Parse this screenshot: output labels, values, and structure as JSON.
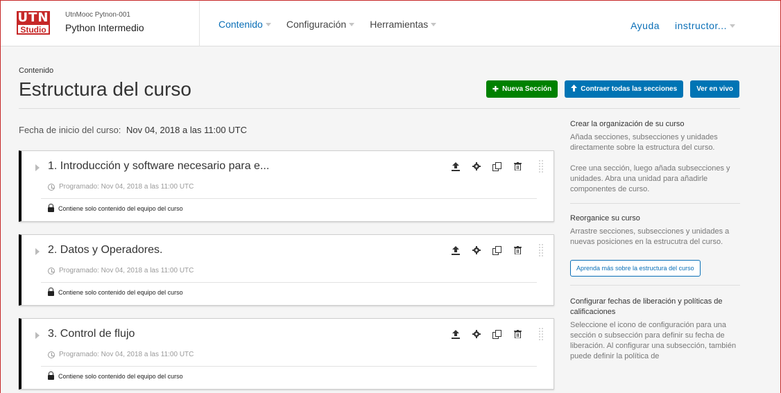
{
  "header": {
    "logo_text": "UTN",
    "logo_sub": "Studio",
    "course_org": "UtnMooc Pytnon-001",
    "course_title": "Python Intermedio",
    "nav": [
      {
        "label": "Contenido"
      },
      {
        "label": "Configuración"
      },
      {
        "label": "Herramientas"
      }
    ],
    "help": "Ayuda",
    "user": "instructor..."
  },
  "page": {
    "breadcrumb": "Contenido",
    "title": "Estructura del curso",
    "actions": {
      "new_section": "Nueva Sección",
      "collapse_all": "Contraer todas las secciones",
      "view_live": "Ver en vivo"
    },
    "start_date_label": "Fecha de inicio del curso:",
    "start_date_value": "Nov 04, 2018 a las 11:00 UTC"
  },
  "sections": [
    {
      "title": "1. Introducción y software necesario para e...",
      "schedule": "Programado: Nov 04, 2018 a las 11:00 UTC",
      "staff_only": "Contiene solo contenido del equipo del curso"
    },
    {
      "title": "2. Datos y Operadores.",
      "schedule": "Programado: Nov 04, 2018 a las 11:00 UTC",
      "staff_only": "Contiene solo contenido del equipo del curso"
    },
    {
      "title": "3. Control de flujo",
      "schedule": "Programado: Nov 04, 2018 a las 11:00 UTC",
      "staff_only": "Contiene solo contenido del equipo del curso"
    }
  ],
  "section_icons": [
    "publish-icon",
    "gear-icon",
    "duplicate-icon",
    "trash-icon"
  ],
  "sidebar": {
    "block1_heading": "Crear la organización de su curso",
    "block1_p1": "Añada secciones, subsecciones y unidades directamente sobre la estructura del curso.",
    "block1_p2": "Cree una sección, luego añada subsecciones y unidades. Abra una unidad para añadirle componentes de curso.",
    "block2_heading": "Reorganice su curso",
    "block2_p1": "Arrastre secciones, subsecciones y unidades a nuevas posiciones en la estrucutra del curso.",
    "block2_link": "Aprenda más sobre la estructura del curso",
    "block3_heading": "Configurar fechas de liberación y políticas de calificaciones",
    "block3_p1": "Seleccione el icono de configuración para una sección o subsección para definir su fecha de liberación. Al configurar una subsección, también puede definir la política de"
  },
  "colors": {
    "brand_red": "#c62828",
    "link_blue": "#0a6fb7",
    "button_green": "#008100",
    "button_blue": "#0074b4"
  }
}
